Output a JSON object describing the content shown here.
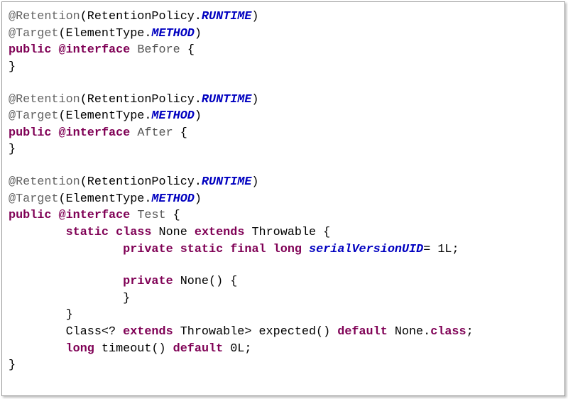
{
  "code_lines": [
    [
      {
        "t": "annotation",
        "v": "@Retention"
      },
      {
        "t": "plain",
        "v": "(RetentionPolicy."
      },
      {
        "t": "constant",
        "v": "RUNTIME"
      },
      {
        "t": "plain",
        "v": ")"
      }
    ],
    [
      {
        "t": "annotation",
        "v": "@Target"
      },
      {
        "t": "plain",
        "v": "(ElementType."
      },
      {
        "t": "constant",
        "v": "METHOD"
      },
      {
        "t": "plain",
        "v": ")"
      }
    ],
    [
      {
        "t": "keyword",
        "v": "public"
      },
      {
        "t": "plain",
        "v": " "
      },
      {
        "t": "keyword",
        "v": "@interface"
      },
      {
        "t": "plain",
        "v": " "
      },
      {
        "t": "name",
        "v": "Before"
      },
      {
        "t": "plain",
        "v": " {"
      }
    ],
    [
      {
        "t": "plain",
        "v": "}"
      }
    ],
    [],
    [
      {
        "t": "annotation",
        "v": "@Retention"
      },
      {
        "t": "plain",
        "v": "(RetentionPolicy."
      },
      {
        "t": "constant",
        "v": "RUNTIME"
      },
      {
        "t": "plain",
        "v": ")"
      }
    ],
    [
      {
        "t": "annotation",
        "v": "@Target"
      },
      {
        "t": "plain",
        "v": "(ElementType."
      },
      {
        "t": "constant",
        "v": "METHOD"
      },
      {
        "t": "plain",
        "v": ")"
      }
    ],
    [
      {
        "t": "keyword",
        "v": "public"
      },
      {
        "t": "plain",
        "v": " "
      },
      {
        "t": "keyword",
        "v": "@interface"
      },
      {
        "t": "plain",
        "v": " "
      },
      {
        "t": "name",
        "v": "After"
      },
      {
        "t": "plain",
        "v": " {"
      }
    ],
    [
      {
        "t": "plain",
        "v": "}"
      }
    ],
    [],
    [
      {
        "t": "annotation",
        "v": "@Retention"
      },
      {
        "t": "plain",
        "v": "(RetentionPolicy."
      },
      {
        "t": "constant",
        "v": "RUNTIME"
      },
      {
        "t": "plain",
        "v": ")"
      }
    ],
    [
      {
        "t": "annotation",
        "v": "@Target"
      },
      {
        "t": "plain",
        "v": "(ElementType."
      },
      {
        "t": "constant",
        "v": "METHOD"
      },
      {
        "t": "plain",
        "v": ")"
      }
    ],
    [
      {
        "t": "keyword",
        "v": "public"
      },
      {
        "t": "plain",
        "v": " "
      },
      {
        "t": "keyword",
        "v": "@interface"
      },
      {
        "t": "plain",
        "v": " "
      },
      {
        "t": "name",
        "v": "Test"
      },
      {
        "t": "plain",
        "v": " {"
      }
    ],
    [
      {
        "t": "plain",
        "v": "        "
      },
      {
        "t": "keyword",
        "v": "static"
      },
      {
        "t": "plain",
        "v": " "
      },
      {
        "t": "keyword",
        "v": "class"
      },
      {
        "t": "plain",
        "v": " None "
      },
      {
        "t": "keyword",
        "v": "extends"
      },
      {
        "t": "plain",
        "v": " Throwable {"
      }
    ],
    [
      {
        "t": "plain",
        "v": "                "
      },
      {
        "t": "keyword",
        "v": "private"
      },
      {
        "t": "plain",
        "v": " "
      },
      {
        "t": "keyword",
        "v": "static"
      },
      {
        "t": "plain",
        "v": " "
      },
      {
        "t": "keyword",
        "v": "final"
      },
      {
        "t": "plain",
        "v": " "
      },
      {
        "t": "keyword",
        "v": "long"
      },
      {
        "t": "plain",
        "v": " "
      },
      {
        "t": "constant",
        "v": "serialVersionUID"
      },
      {
        "t": "plain",
        "v": "= "
      },
      {
        "t": "number",
        "v": "1L"
      },
      {
        "t": "plain",
        "v": ";"
      }
    ],
    [],
    [
      {
        "t": "plain",
        "v": "                "
      },
      {
        "t": "keyword",
        "v": "private"
      },
      {
        "t": "plain",
        "v": " None() {"
      }
    ],
    [
      {
        "t": "plain",
        "v": "                }"
      }
    ],
    [
      {
        "t": "plain",
        "v": "        }"
      }
    ],
    [
      {
        "t": "plain",
        "v": "        Class<? "
      },
      {
        "t": "keyword",
        "v": "extends"
      },
      {
        "t": "plain",
        "v": " Throwable> expected() "
      },
      {
        "t": "keyword",
        "v": "default"
      },
      {
        "t": "plain",
        "v": " None."
      },
      {
        "t": "keyword",
        "v": "class"
      },
      {
        "t": "plain",
        "v": ";"
      }
    ],
    [
      {
        "t": "plain",
        "v": "        "
      },
      {
        "t": "keyword",
        "v": "long"
      },
      {
        "t": "plain",
        "v": " timeout() "
      },
      {
        "t": "keyword",
        "v": "default"
      },
      {
        "t": "plain",
        "v": " "
      },
      {
        "t": "number",
        "v": "0L"
      },
      {
        "t": "plain",
        "v": ";"
      }
    ],
    [
      {
        "t": "plain",
        "v": "}"
      }
    ]
  ],
  "colors": {
    "annotation": "#646464",
    "keyword": "#7f0055",
    "constant": "#0000c0",
    "name": "#555555",
    "plain": "#000000"
  }
}
